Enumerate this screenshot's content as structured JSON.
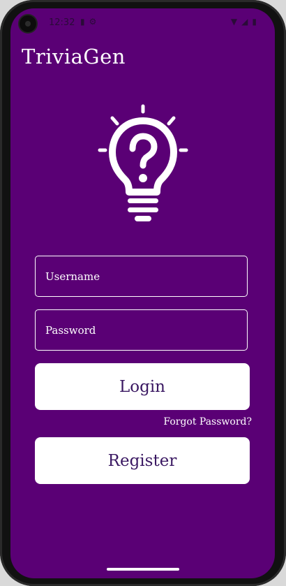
{
  "status_bar": {
    "time": "12:32",
    "left_icons": [
      "sd-card-icon",
      "settings-icon"
    ],
    "right_icons": [
      "wifi-icon",
      "signal-icon",
      "battery-icon"
    ]
  },
  "app": {
    "title": "TriviaGen"
  },
  "logo": {
    "icon": "lightbulb-question-icon"
  },
  "form": {
    "username_placeholder": "Username",
    "password_placeholder": "Password"
  },
  "actions": {
    "login_label": "Login",
    "forgot_label": "Forgot Password?",
    "register_label": "Register"
  },
  "colors": {
    "background": "#5a0075",
    "button": "#ffffff",
    "button_text": "#3a1862"
  }
}
